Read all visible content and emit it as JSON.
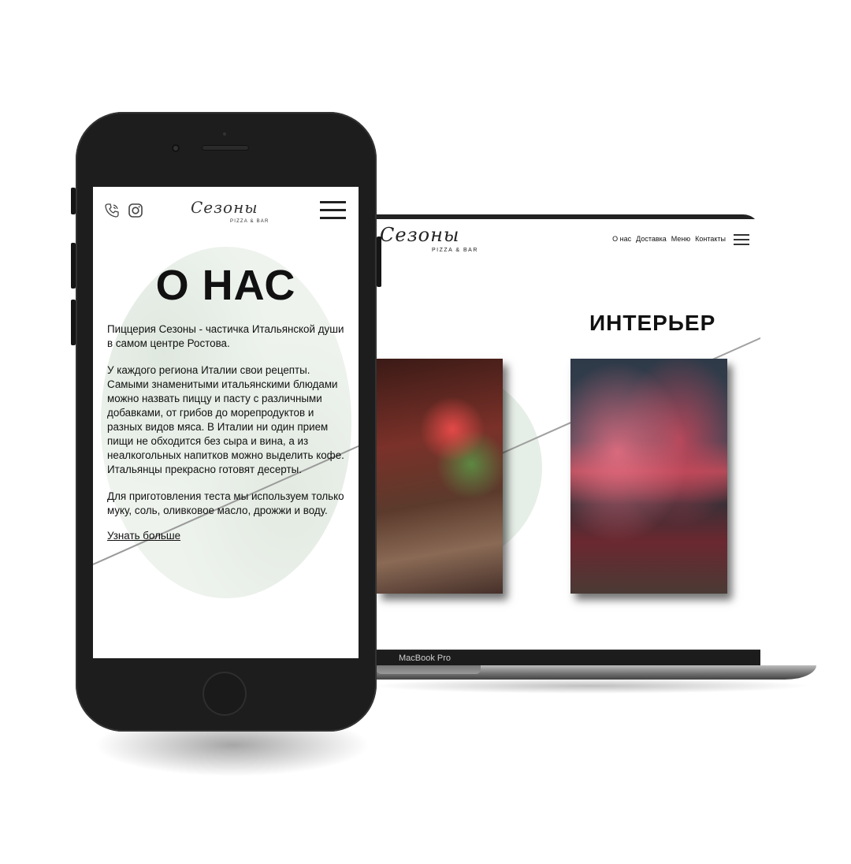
{
  "phone": {
    "logo_script": "Сезоны",
    "logo_sub": "PIZZA & BAR",
    "title": "О НАС",
    "paragraphs": [
      "Пиццерия Сезоны - частичка Итальянской души в самом центре Ростова.",
      "У каждого региона Италии свои рецепты. Самыми знаменитыми итальянскими блюдами можно назвать пиццу и пасту с различными добавками, от грибов до морепродуктов и разных видов мяса. В Италии ни один прием пищи не обходится без сыра и вина, а из неалкогольных напитков можно выделить кофе. Итальянцы прекрасно готовят десерты.",
      "Для приготовления теста мы используем только муку, соль, оливковое масло, дрожжи и воду."
    ],
    "more_link": "Узнать больше",
    "icons": [
      "phone-icon",
      "instagram-icon",
      "menu-icon"
    ]
  },
  "laptop": {
    "logo_script": "Сезоны",
    "logo_sub": "PIZZA & BAR",
    "nav": [
      "О нас",
      "Доставка",
      "Меню",
      "Контакты"
    ],
    "section_title": "ИНТЕРЬЕР",
    "brand": "MacBook Pro"
  }
}
